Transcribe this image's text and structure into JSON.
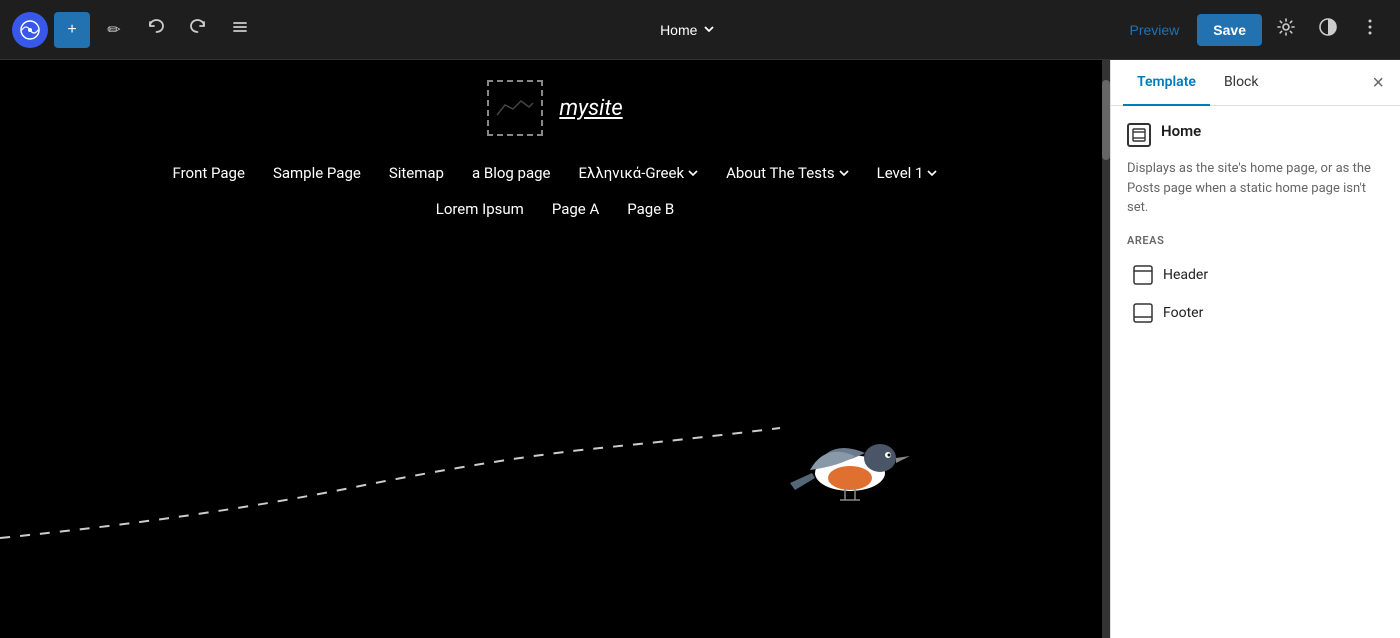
{
  "toolbar": {
    "wp_logo": "W",
    "add_label": "+",
    "pen_label": "✏",
    "undo_label": "↺",
    "redo_label": "↻",
    "list_label": "≡",
    "page_title": "Home",
    "page_dropdown_icon": "∨",
    "preview_label": "Preview",
    "save_label": "Save",
    "settings_icon": "⚙",
    "contrast_icon": "◑",
    "more_icon": "⋮"
  },
  "panel": {
    "tab_template": "Template",
    "tab_block": "Block",
    "active_tab": "Template",
    "close_icon": "×",
    "home_title": "Home",
    "home_description": "Displays as the site's home page, or as the Posts page when a static home page isn't set.",
    "areas_label": "AREAS",
    "area_header": "Header",
    "area_footer": "Footer"
  },
  "canvas": {
    "site_name": "mysite",
    "nav_items": [
      {
        "label": "Front Page"
      },
      {
        "label": "Sample Page"
      },
      {
        "label": "Sitemap"
      },
      {
        "label": "a Blog page"
      },
      {
        "label": "Ελληνικά-Greek",
        "dropdown": true
      },
      {
        "label": "About The Tests",
        "dropdown": true
      },
      {
        "label": "Level 1",
        "dropdown": true
      }
    ],
    "sub_nav_items": [
      {
        "label": "Lorem Ipsum"
      },
      {
        "label": "Page A"
      },
      {
        "label": "Page B"
      }
    ]
  }
}
